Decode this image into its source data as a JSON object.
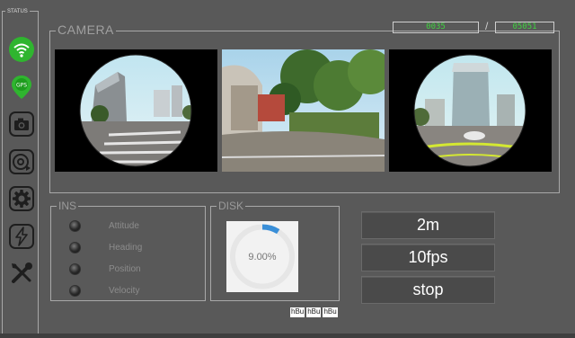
{
  "status": {
    "legend": "STATUS",
    "icons": [
      "wifi-icon",
      "gps-icon",
      "camera-icon",
      "record-disk-icon",
      "gear-icon",
      "power-icon",
      "tools-icon"
    ],
    "gps_text": "GPS",
    "active_color": "#3fd23f"
  },
  "camera": {
    "legend": "CAMERA",
    "counter_left": "0035",
    "counter_sep": "/",
    "counter_right": "05051",
    "views": [
      "fisheye-left",
      "front-wide",
      "fisheye-right"
    ]
  },
  "ins": {
    "legend": "INS",
    "items": [
      "Attitude",
      "Heading",
      "Position",
      "Velocity"
    ]
  },
  "disk": {
    "legend": "DISK",
    "percent_text": "9.00%",
    "usage_fraction": 0.09,
    "tags": [
      "hBu",
      "hBu",
      "hBu"
    ]
  },
  "controls": {
    "interval_label": "2m",
    "fps_label": "10fps",
    "stop_label": "stop"
  },
  "colors": {
    "background": "#595959",
    "gauge": "#3a8fd8",
    "counter_text": "#3fd23f"
  }
}
